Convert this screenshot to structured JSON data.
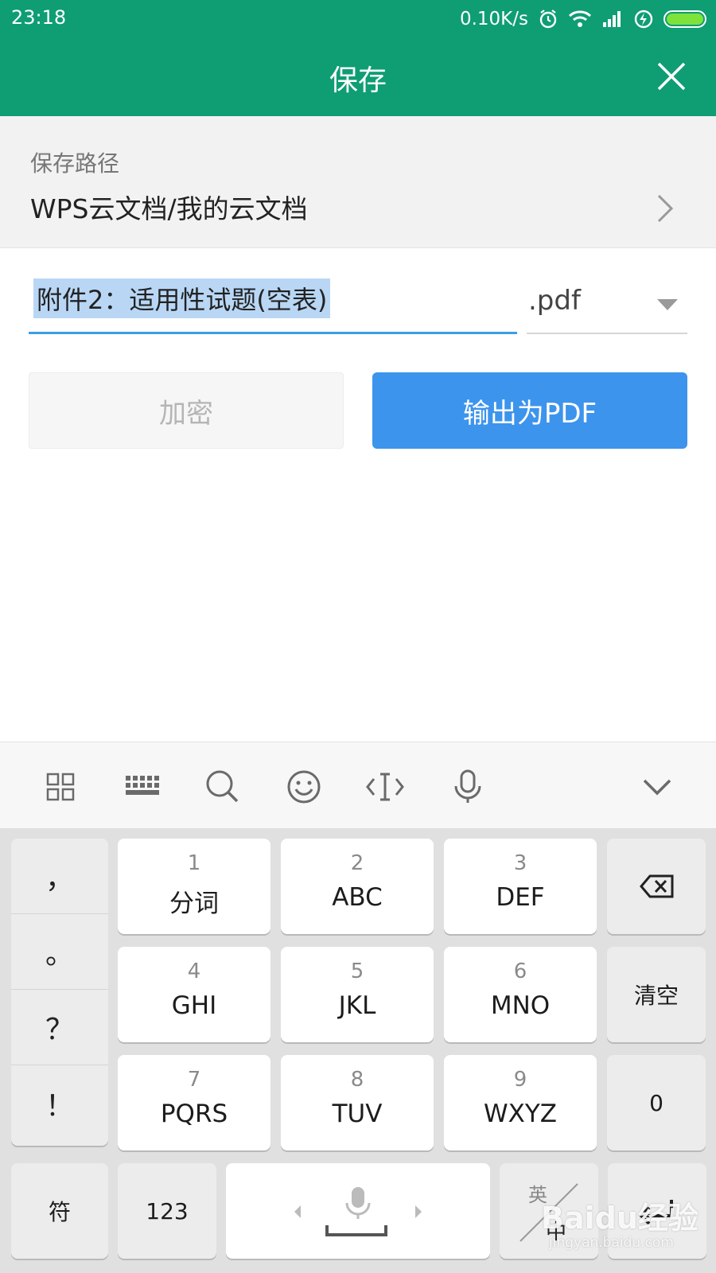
{
  "status": {
    "time": "23:18",
    "speed": "0.10K/s"
  },
  "header": {
    "title": "保存"
  },
  "save_path": {
    "label": "保存路径",
    "value": "WPS云文档/我的云文档"
  },
  "file": {
    "name": "附件2：适用性试题(空表)",
    "extension": ".pdf"
  },
  "actions": {
    "encrypt_label": "加密",
    "export_label": "输出为PDF"
  },
  "keyboard": {
    "punctuation": [
      "，",
      "。",
      "？",
      "！"
    ],
    "keys": [
      {
        "num": "1",
        "letters": "分词"
      },
      {
        "num": "2",
        "letters": "ABC"
      },
      {
        "num": "3",
        "letters": "DEF"
      },
      {
        "num": "4",
        "letters": "GHI"
      },
      {
        "num": "5",
        "letters": "JKL"
      },
      {
        "num": "6",
        "letters": "MNO"
      },
      {
        "num": "7",
        "letters": "PQRS"
      },
      {
        "num": "8",
        "letters": "TUV"
      },
      {
        "num": "9",
        "letters": "WXYZ"
      }
    ],
    "clear_label": "清空",
    "zero_label": "0",
    "symbols_label": "符",
    "numbers_label": "123",
    "lang_label": "英",
    "lang_sub": "中"
  },
  "watermark": {
    "text": "Baidu经验",
    "url": "jingyan.baidu.com"
  },
  "colors": {
    "primary": "#0f9d74",
    "accent": "#3d94ec",
    "selection": "#b9d7f5"
  }
}
